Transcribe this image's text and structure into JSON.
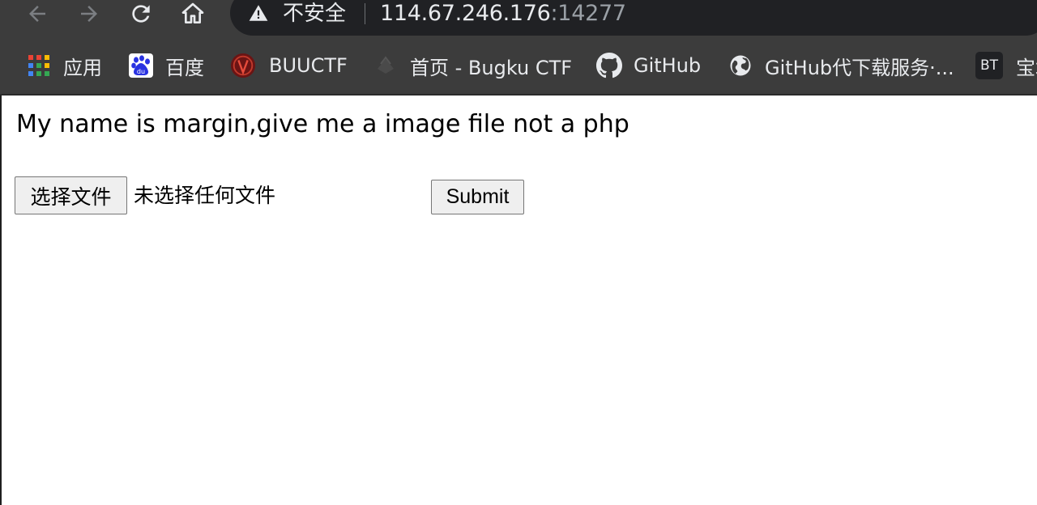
{
  "browser": {
    "nav": {
      "back_icon": "arrow-left-icon",
      "forward_icon": "arrow-right-icon",
      "reload_icon": "reload-icon",
      "home_icon": "home-icon"
    },
    "omnibox": {
      "security_label": "不安全",
      "host": "114.67.246.176",
      "port": ":14277"
    },
    "bookmarks": [
      {
        "label": "应用",
        "icon": "apps-grid-icon"
      },
      {
        "label": "百度",
        "icon": "baidu-paw-icon"
      },
      {
        "label": "BUUCTF",
        "icon": "buuctf-logo-icon"
      },
      {
        "label": "首页 - Bugku CTF",
        "icon": "bugku-logo-icon"
      },
      {
        "label": "GitHub",
        "icon": "github-icon"
      },
      {
        "label": "GitHub代下载服务·...",
        "icon": "globe-icon"
      },
      {
        "label": "BT",
        "icon": "bt-badge-icon"
      },
      {
        "label": "宝塔",
        "icon": ""
      }
    ]
  },
  "page": {
    "heading": "My name is margin,give me a image file not a php",
    "file_button_label": "选择文件",
    "file_status": "未选择任何文件",
    "submit_label": "Submit"
  },
  "colors": {
    "chrome_bg": "#3c3c3c",
    "omnibox_bg": "#202124",
    "chrome_text": "#e8eaed",
    "port_text": "#9aa0a6",
    "button_bg": "#efefef"
  }
}
